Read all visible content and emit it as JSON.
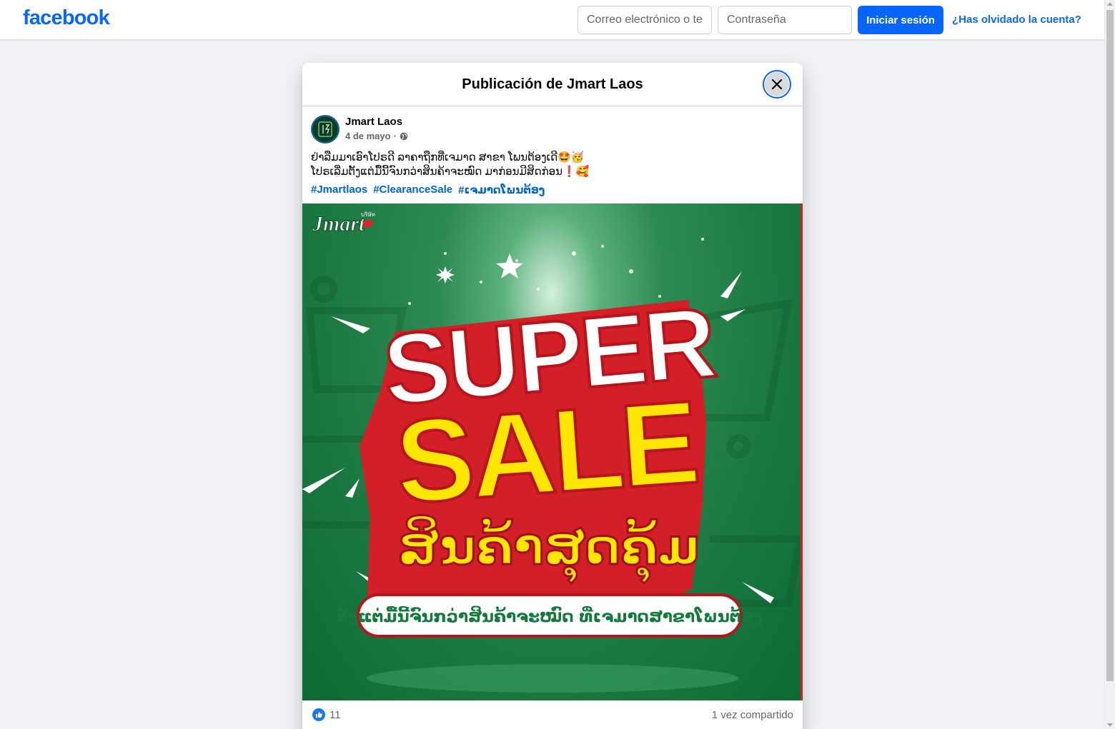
{
  "header": {
    "logo": "facebook",
    "email_placeholder": "Correo electrónico o teléfono",
    "password_placeholder": "Contraseña",
    "login_label": "Iniciar sesión",
    "forgot_label": "¿Has olvidado la cuenta?"
  },
  "dialog": {
    "title": "Publicación de Jmart Laos"
  },
  "post": {
    "author": "Jmart Laos",
    "date": "4 de mayo",
    "meta_separator": "·",
    "text_line1": "ຢ່າລືມມາເອົາໂປຣດີ ລາຄາຖືກທີ່ເຈມາດ ສາຂາ ໂພນຕ້ອງເດີ🤩🥳",
    "text_line2": "ໂປຣເລີ່ມຕັ້ງແຕ່ມື້ນີ້ຈົນກວ່າສິນຄ້າຈະໝົດ ມາກ່ອນມີສິດກ່ອນ❗🥰",
    "hashtags": [
      "#Jmartlaos",
      "#ClearanceSale",
      "#ເຈມາດໂພນຕ້ອງ"
    ]
  },
  "image": {
    "brand": "Jmart",
    "brand_tag": "บริษัท",
    "headline1": "SUPER",
    "headline2": "SALE",
    "headline3": "ສິນຄ້າສຸດຄຸ້ມ",
    "banner": "ຕັ້ງແຕ່ມື້ນີ້ຈົນກວ່າສິນຄ້າຈະໝົດ ທີ່ເຈມາດສາຂາໂພນຕ້ອງ"
  },
  "stats": {
    "likes": "11",
    "shares": "1 vez compartido"
  },
  "colors": {
    "brand_blue": "#0866ff",
    "sale_red": "#e0232b",
    "sale_yellow": "#ffe600",
    "green_bg": "#1c7a42"
  }
}
